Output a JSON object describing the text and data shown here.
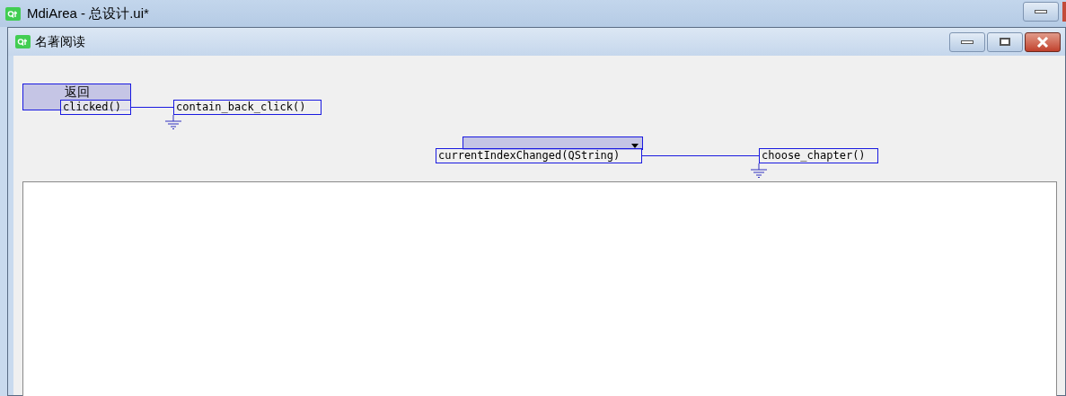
{
  "window": {
    "title": "MdiArea - 总设计.ui*"
  },
  "subwindow": {
    "title": "名著阅读"
  },
  "form": {
    "button": {
      "label": "返回"
    },
    "connections": [
      {
        "kind": "button",
        "signal": "clicked()",
        "slot": "contain_back_click()"
      },
      {
        "kind": "combo",
        "signal": "currentIndexChanged(QString)",
        "slot": "choose_chapter()"
      }
    ]
  }
}
